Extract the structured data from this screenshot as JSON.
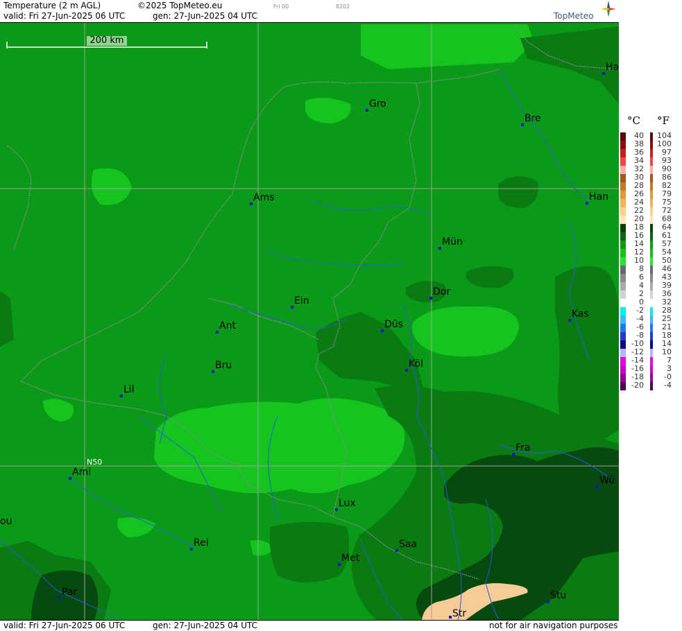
{
  "header": {
    "product": "Temperature (2 m AGL)",
    "copyright": "©2025 TopMeteo.eu",
    "run_tag": "Fri 00",
    "code": "8202",
    "valid": "valid:  Fri  27-Jun-2025  06 UTC",
    "gen": "gen:  27-Jun-2025  04 UTC",
    "brand": "TopMeteo"
  },
  "footer": {
    "valid": "valid:  Fri  27-Jun-2025  06 UTC",
    "gen": "gen:  27-Jun-2025  04 UTC",
    "disclaimer": "not for air navigation purposes"
  },
  "scale_bar": {
    "label": "200 km"
  },
  "grid_label": "N50",
  "cities": [
    {
      "name": "Gro"
    },
    {
      "name": "Bre"
    },
    {
      "name": "Ha"
    },
    {
      "name": "Ams"
    },
    {
      "name": "Han"
    },
    {
      "name": "Mün"
    },
    {
      "name": "Dor"
    },
    {
      "name": "Ein"
    },
    {
      "name": "Ant"
    },
    {
      "name": "Düs"
    },
    {
      "name": "Kas"
    },
    {
      "name": "Bru"
    },
    {
      "name": "Köl"
    },
    {
      "name": "Lil"
    },
    {
      "name": "Fra"
    },
    {
      "name": "Ami"
    },
    {
      "name": "Wü"
    },
    {
      "name": "Lux"
    },
    {
      "name": "ou"
    },
    {
      "name": "Rei"
    },
    {
      "name": "Saa"
    },
    {
      "name": "Met"
    },
    {
      "name": "Par"
    },
    {
      "name": "Stu"
    },
    {
      "name": "Str"
    }
  ],
  "legend": {
    "celsius_unit": "°C",
    "fahrenheit_unit": "°F",
    "celsius": [
      "40",
      "38",
      "36",
      "34",
      "32",
      "30",
      "28",
      "26",
      "24",
      "22",
      "20",
      "18",
      "16",
      "14",
      "12",
      "10",
      "8",
      "6",
      "4",
      "2",
      "0",
      "-2",
      "-4",
      "-6",
      "-8",
      "-10",
      "-12",
      "-14",
      "-16",
      "-18",
      "-20"
    ],
    "fahrenheit": [
      "104",
      "100",
      "97",
      "93",
      "90",
      "86",
      "82",
      "79",
      "75",
      "72",
      "68",
      "64",
      "61",
      "57",
      "54",
      "50",
      "46",
      "43",
      "39",
      "36",
      "32",
      "28",
      "25",
      "21",
      "18",
      "14",
      "10",
      "7",
      "3",
      "-0",
      "-4"
    ],
    "colors": [
      "#5a0a0a",
      "#8a1010",
      "#c81e1e",
      "#f04646",
      "#ffaaaa",
      "#a05a1e",
      "#c87828",
      "#e09a3c",
      "#f0b45a",
      "#ffd28c",
      "#ffe6b4",
      "#064006",
      "#0a6a0a",
      "#109a10",
      "#16c016",
      "#2ee02e",
      "#6a6a6a",
      "#8a8a8a",
      "#aaaaaa",
      "#d2d2d2",
      "#ffffff",
      "#00f0f0",
      "#3cb4ff",
      "#1e78f0",
      "#1e3cc8",
      "#0a0a82",
      "#b4b4ff",
      "#e600e6",
      "#c800c8",
      "#960096",
      "#500050"
    ],
    "field_colors": {
      "t12": "#0b9a18",
      "t14": "#16c41f",
      "t16": "#0a7a12",
      "t18": "#064a10",
      "t20": "#f5cc98"
    }
  }
}
